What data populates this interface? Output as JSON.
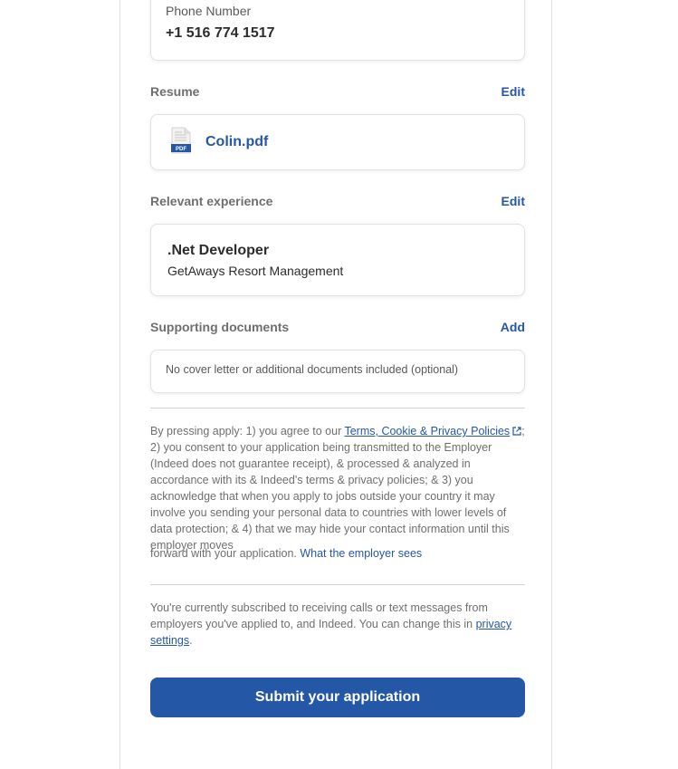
{
  "phone": {
    "label": "Phone Number",
    "value": "+1 516 774 1517"
  },
  "resume": {
    "title": "Resume",
    "action": "Edit",
    "file_name": "Colin.pdf",
    "file_icon": "pdf-file-icon",
    "file_icon_text": "PDF"
  },
  "experience": {
    "title": "Relevant experience",
    "action": "Edit",
    "job_title": ".Net Developer",
    "company": "GetAways Resort Management"
  },
  "supporting_docs": {
    "title": "Supporting documents",
    "action": "Add",
    "empty_text": "No cover letter or additional documents included (optional)"
  },
  "legal": {
    "intro": "By pressing apply: 1) you agree to our ",
    "terms_link": "Terms, Cookie & Privacy Policies",
    "body": "; 2) you consent to your application being transmitted to the Employer (Indeed does not guarantee receipt), & processed & analyzed in accordance with its & Indeed's terms & privacy policies; & 3) you acknowledge that when you apply to jobs outside your country it may involve you sending your personal data to countries with lower levels of data protection; & 4) that we may hide your contact information until this employer moves",
    "forward_text": "forward with your application. ",
    "employer_link": "What the employer sees"
  },
  "subscription": {
    "text": "You're currently subscribed to receiving calls or text messages from employers you've applied to, and Indeed. You can change this in ",
    "link": "privacy settings",
    "end": "."
  },
  "submit": {
    "label": "Submit your application"
  },
  "colors": {
    "accent": "#2557a7",
    "text": "#2d2d2d",
    "muted": "#6f6f6f",
    "border": "#e4e2e0"
  }
}
